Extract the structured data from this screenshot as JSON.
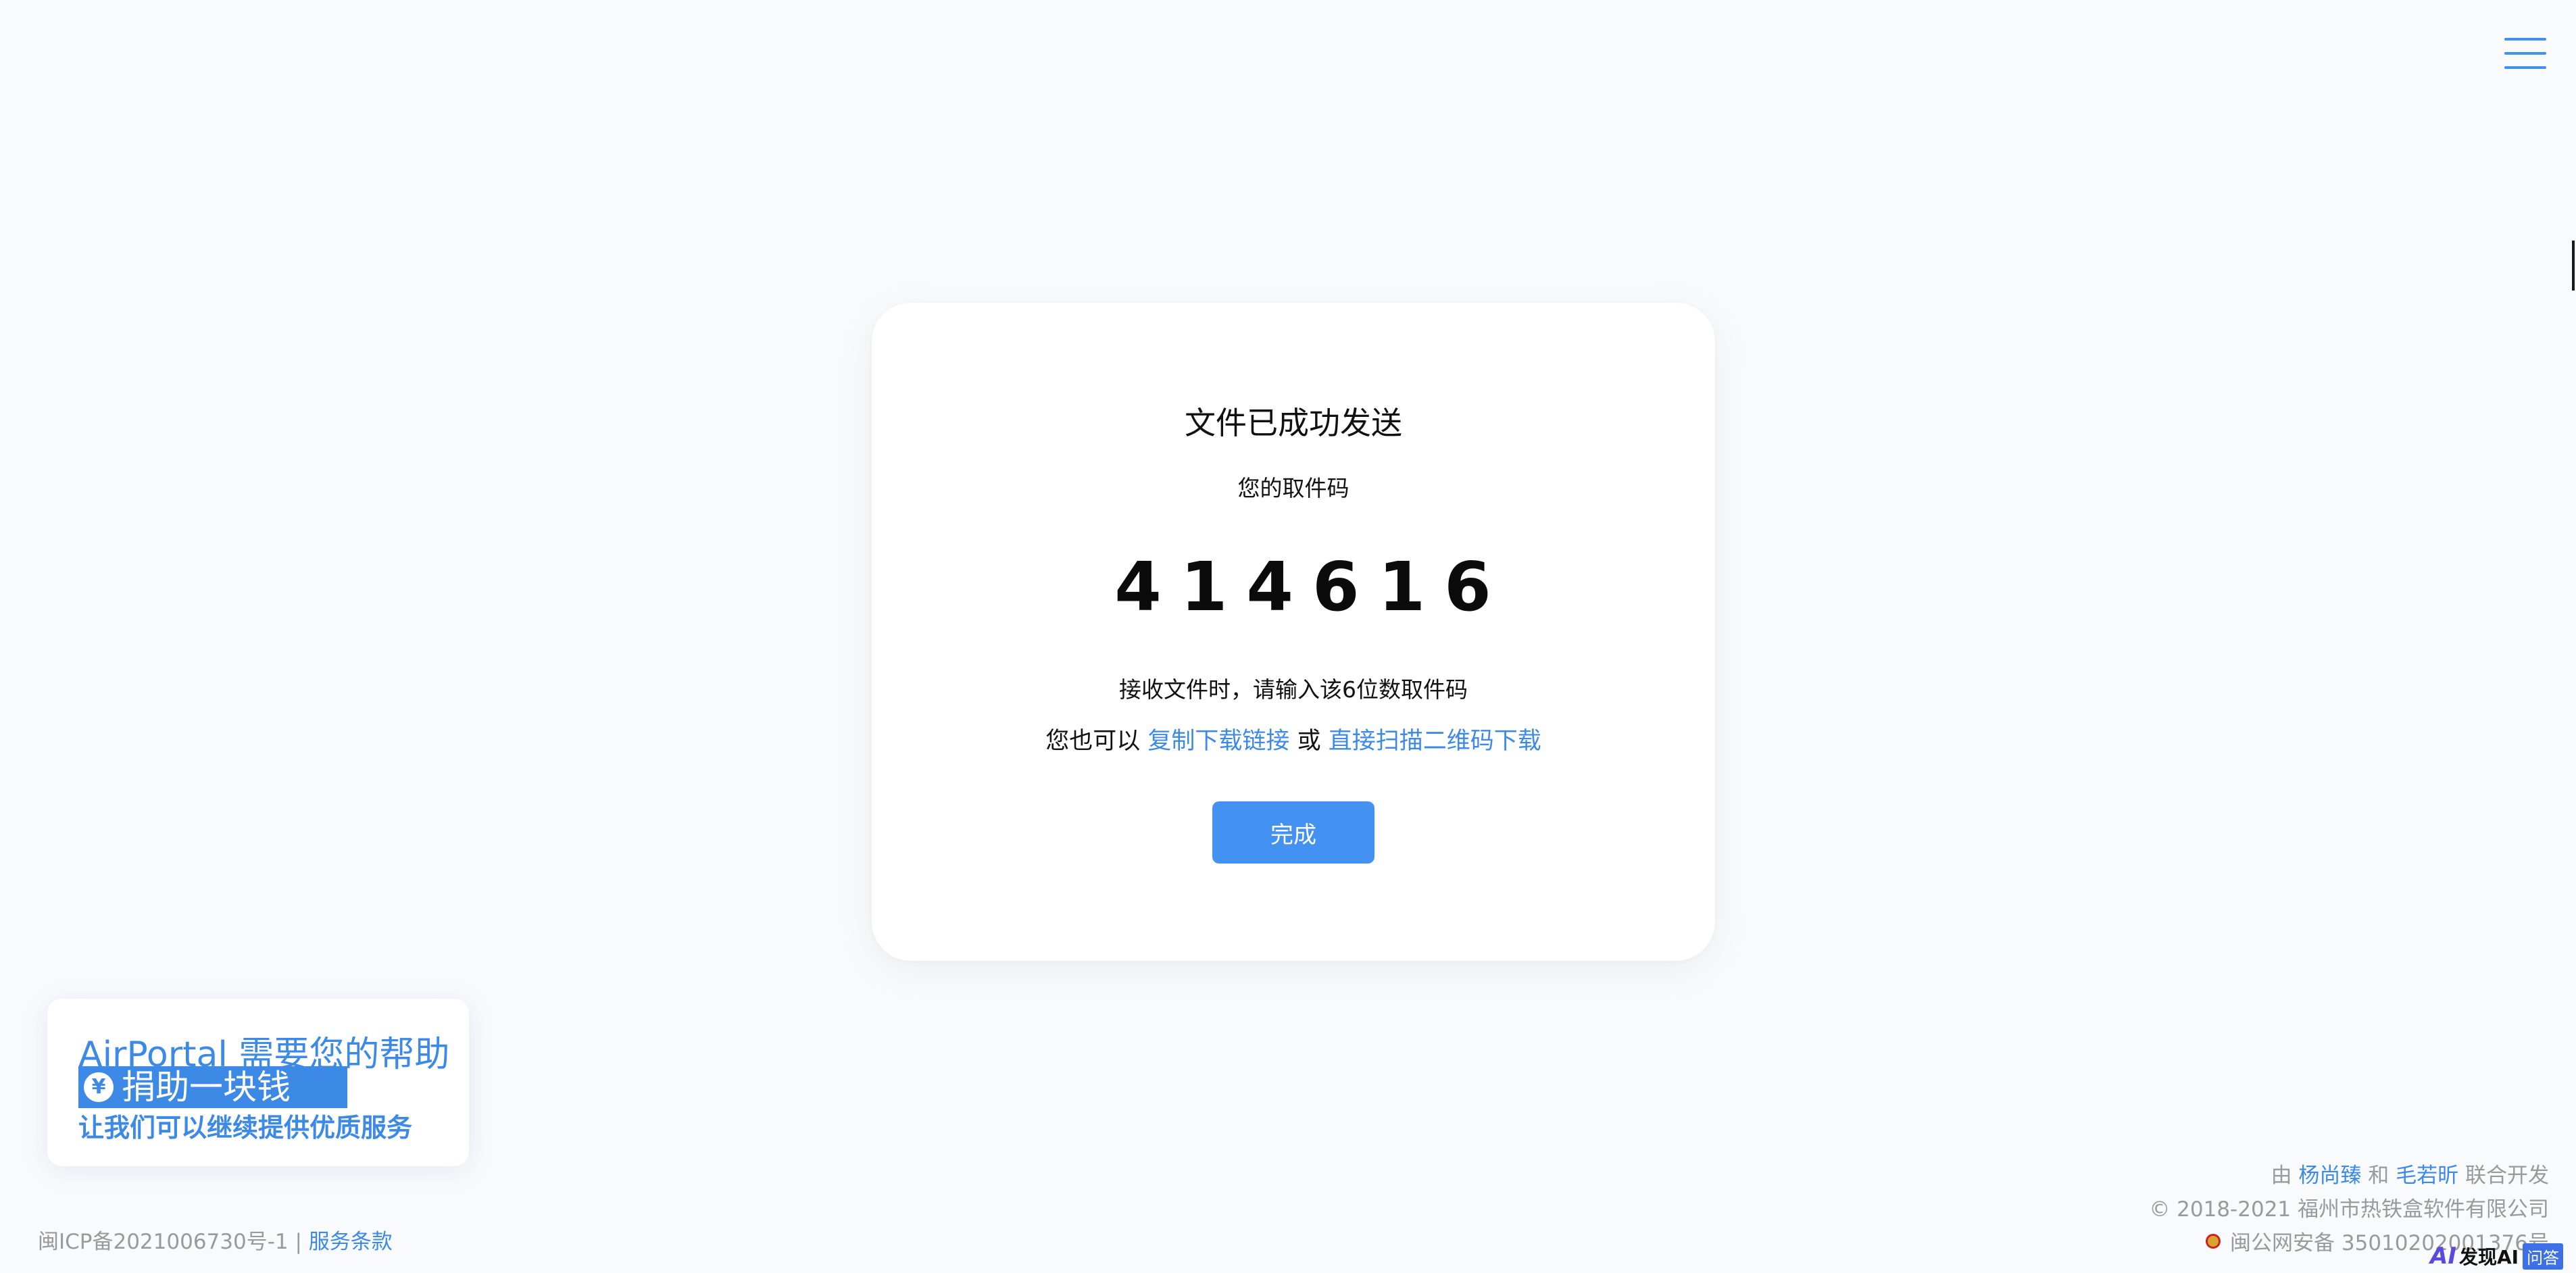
{
  "header": {
    "menu_icon": "hamburger-menu-icon"
  },
  "card": {
    "title": "文件已成功发送",
    "code_label": "您的取件码",
    "code": "414616",
    "hint": "接收文件时，请输入该6位数取件码",
    "alt_prefix": "您也可以",
    "copy_link": "复制下载链接",
    "alt_or": "或",
    "qr_link": "直接扫描二维码下载",
    "done_button": "完成"
  },
  "donate": {
    "title": "AirPortal 需要您的帮助",
    "yen_icon": "¥",
    "button": "捐助一块钱",
    "subtitle": "让我们可以继续提供优质服务"
  },
  "footer": {
    "icp": "闽ICP备2021006730号-1",
    "separator": "|",
    "terms": "服务条款",
    "dev_prefix": "由",
    "dev1": "杨尚臻",
    "dev_and": "和",
    "dev2": "毛若昕",
    "dev_suffix": "联合开发",
    "copyright": "© 2018-2021 福州市热铁盒软件有限公司",
    "police": "闽公网安备 35010202001376号"
  },
  "watermark": {
    "mark": "AI",
    "text": "发现AI",
    "qa": "问答"
  },
  "colors": {
    "accent": "#4392f1",
    "link": "#3d8ae6",
    "background": "#f9fafb"
  }
}
